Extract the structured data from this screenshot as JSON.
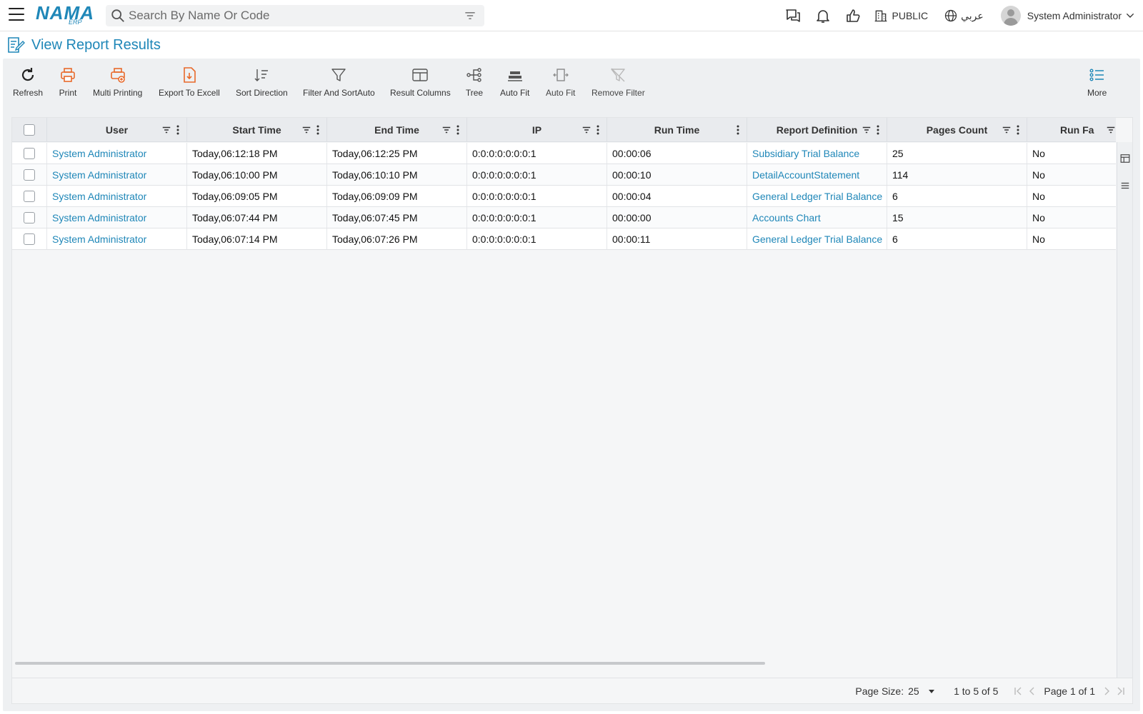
{
  "app": {
    "logo": "NAMA",
    "logo_sub": "ERP"
  },
  "search": {
    "placeholder": "Search By Name Or Code"
  },
  "topbar": {
    "public_label": "PUBLIC",
    "language_label": "عربي",
    "user_name": "System Administrator"
  },
  "page": {
    "title": "View Report Results"
  },
  "toolbar": {
    "refresh": "Refresh",
    "print": "Print",
    "multi_printing": "Multi Printing",
    "export_excel": "Export To Excell",
    "sort_direction": "Sort Direction",
    "filter_sort": "Filter And SortAuto",
    "result_columns": "Result Columns",
    "tree": "Tree",
    "auto_fit_1": "Auto Fit",
    "auto_fit_2": "Auto Fit",
    "remove_filter": "Remove Filter",
    "more": "More"
  },
  "table": {
    "columns": [
      "User",
      "Start Time",
      "End Time",
      "IP",
      "Run Time",
      "Report Definition",
      "Pages Count",
      "Run Fa"
    ],
    "rows": [
      [
        "System Administrator",
        "Today,06:12:18 PM",
        "Today,06:12:25 PM",
        "0:0:0:0:0:0:0:1",
        "00:00:06",
        "Subsidiary Trial Balance",
        "25",
        "No"
      ],
      [
        "System Administrator",
        "Today,06:10:00 PM",
        "Today,06:10:10 PM",
        "0:0:0:0:0:0:0:1",
        "00:00:10",
        "DetailAccountStatement",
        "114",
        "No"
      ],
      [
        "System Administrator",
        "Today,06:09:05 PM",
        "Today,06:09:09 PM",
        "0:0:0:0:0:0:0:1",
        "00:00:04",
        "General Ledger Trial Balance",
        "6",
        "No"
      ],
      [
        "System Administrator",
        "Today,06:07:44 PM",
        "Today,06:07:45 PM",
        "0:0:0:0:0:0:0:1",
        "00:00:00",
        "Accounts Chart",
        "15",
        "No"
      ],
      [
        "System Administrator",
        "Today,06:07:14 PM",
        "Today,06:07:26 PM",
        "0:0:0:0:0:0:0:1",
        "00:00:11",
        "General Ledger Trial Balance",
        "6",
        "No"
      ]
    ]
  },
  "footer": {
    "page_size_label": "Page Size:",
    "page_size_value": "25",
    "range_text": "1 to 5 of 5",
    "page_text": "Page 1 of 1"
  },
  "colors": {
    "accent": "#1f87b8",
    "orange": "#e8692a",
    "panel_bg": "#eef0f2"
  }
}
